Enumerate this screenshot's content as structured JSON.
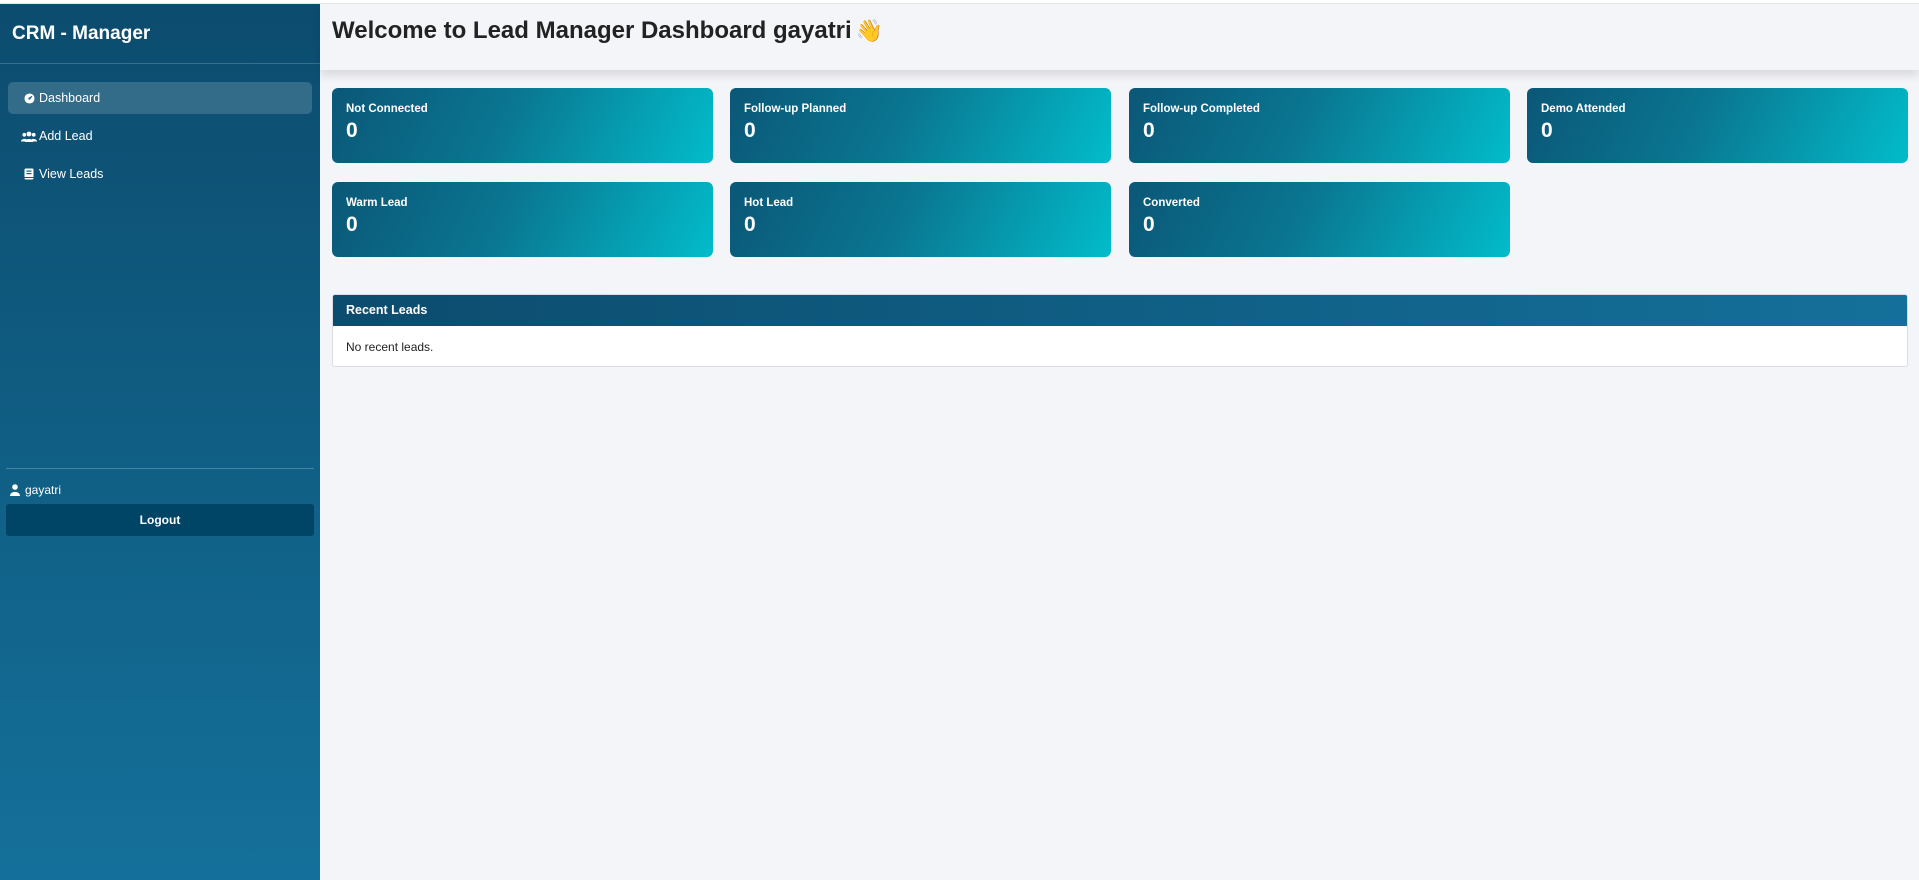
{
  "sidebar": {
    "brand": "CRM - Manager",
    "items": [
      {
        "label": "Dashboard",
        "icon": "dashboard-icon",
        "active": true
      },
      {
        "label": "Add Lead",
        "icon": "users-icon",
        "active": false
      },
      {
        "label": "View Leads",
        "icon": "book-icon",
        "active": false
      }
    ],
    "user": {
      "name": "gayatri",
      "icon": "user-icon"
    },
    "logout_label": "Logout"
  },
  "header": {
    "title": "Welcome to Lead Manager Dashboard gayatri",
    "emoji": "👋"
  },
  "stats": [
    {
      "label": "Not Connected",
      "value": "0"
    },
    {
      "label": "Follow-up Planned",
      "value": "0"
    },
    {
      "label": "Follow-up Completed",
      "value": "0"
    },
    {
      "label": "Demo Attended",
      "value": "0"
    },
    {
      "label": "Warm Lead",
      "value": "0"
    },
    {
      "label": "Hot Lead",
      "value": "0"
    },
    {
      "label": "Converted",
      "value": "0"
    }
  ],
  "recent_leads": {
    "title": "Recent Leads",
    "empty_text": "No recent leads."
  },
  "colors": {
    "sidebar_top": "#0c4c6e",
    "sidebar_bottom": "#14709a",
    "card_start": "#0b5777",
    "card_end": "#02bcca",
    "logout_bg": "#004466",
    "page_bg": "#f4f5f9"
  }
}
